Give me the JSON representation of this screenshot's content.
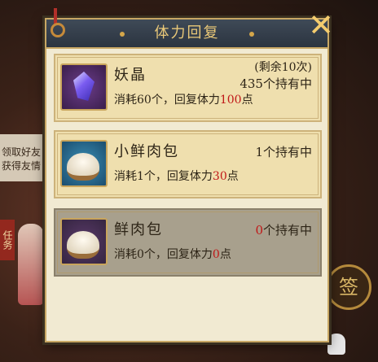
{
  "background": {
    "left_panel_line1": "领取好友",
    "left_panel_line2": "获得友情",
    "task_label": "任务",
    "sign_label": "签"
  },
  "dialog": {
    "title": "体力回复",
    "close_label": "✕"
  },
  "items": [
    {
      "name": "妖晶",
      "remaining": "(剩余10次)",
      "count_value": "435",
      "count_suffix": "个持有中",
      "desc_prefix": "消耗60个，回复体力",
      "desc_value": "100",
      "desc_suffix": "点"
    },
    {
      "name": "小鲜肉包",
      "count_value": "1",
      "count_suffix": "个持有中",
      "desc_prefix": "消耗1个，回复体力",
      "desc_value": "30",
      "desc_suffix": "点"
    },
    {
      "name": "鲜肉包",
      "count_value": "0",
      "count_suffix": "个持有中",
      "desc_prefix": "消耗0个，回复体力",
      "desc_value": "0",
      "desc_suffix": "点"
    }
  ],
  "colors": {
    "accent": "#e9c878",
    "highlight": "#c01818"
  }
}
